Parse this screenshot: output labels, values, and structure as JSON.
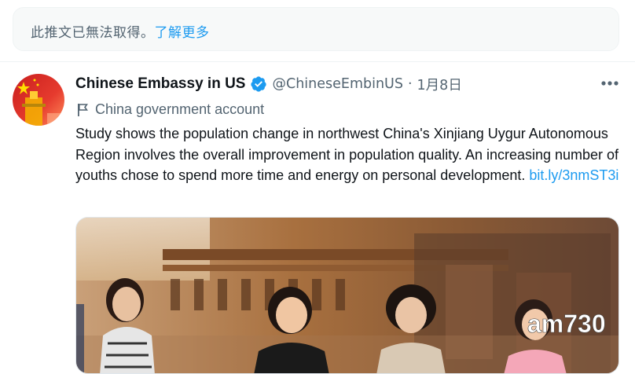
{
  "notice": {
    "text": "此推文已無法取得。",
    "link": "了解更多"
  },
  "tweet": {
    "display_name": "Chinese Embassy in US",
    "handle": "@ChineseEmbinUS",
    "separator": "·",
    "date": "1月8日",
    "label": "China government account",
    "text_main": "Study shows the population change in northwest China's Xinjiang Uygur Autonomous Region involves the overall improvement in population quality. An increasing number of youths chose to spend more time and energy on personal development. ",
    "link": "bit.ly/3nmST3i",
    "verified_icon": "verified-badge-icon",
    "more_icon": "more-options-icon",
    "flag_icon": "flag-icon"
  },
  "media": {
    "watermark": "am730"
  },
  "colors": {
    "link": "#1d9bf0",
    "secondary_text": "#536471",
    "primary_text": "#0f1419"
  }
}
